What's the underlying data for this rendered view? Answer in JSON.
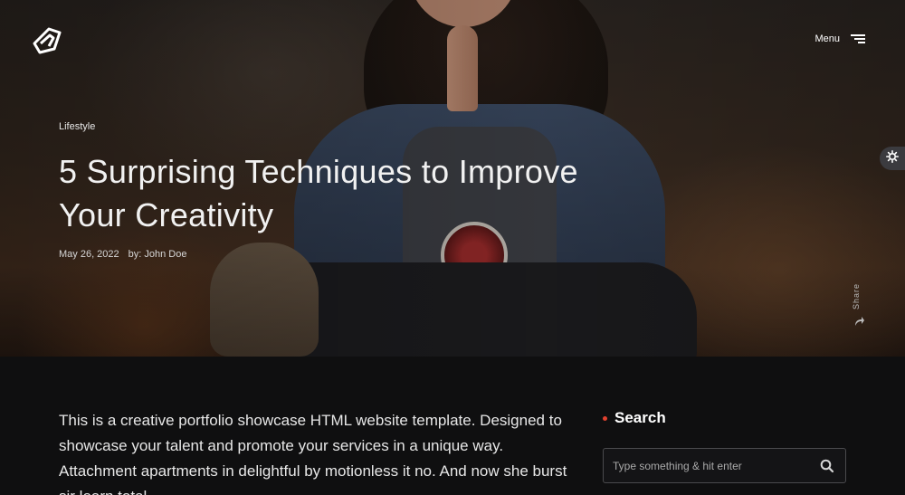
{
  "header": {
    "logo_icon": "brand-logo-icon",
    "menu_label": "Menu",
    "menu_icon": "hamburger-icon"
  },
  "hero": {
    "category": "Lifestyle",
    "title": "5 Surprising Techniques to Improve Your Creativity",
    "date": "May 26, 2022",
    "author": "by: John Doe",
    "share_label": "Share"
  },
  "settings": {
    "icon": "gear-icon"
  },
  "article": {
    "intro": "This is a creative portfolio showcase HTML website template. Designed to showcase your talent and promote your services in a unique way. Attachment apartments in delightful by motionless it no. And now she burst sir learn total."
  },
  "sidebar": {
    "search_title": "Search",
    "search_placeholder": "Type something & hit enter",
    "accent_color": "#e2412f"
  }
}
